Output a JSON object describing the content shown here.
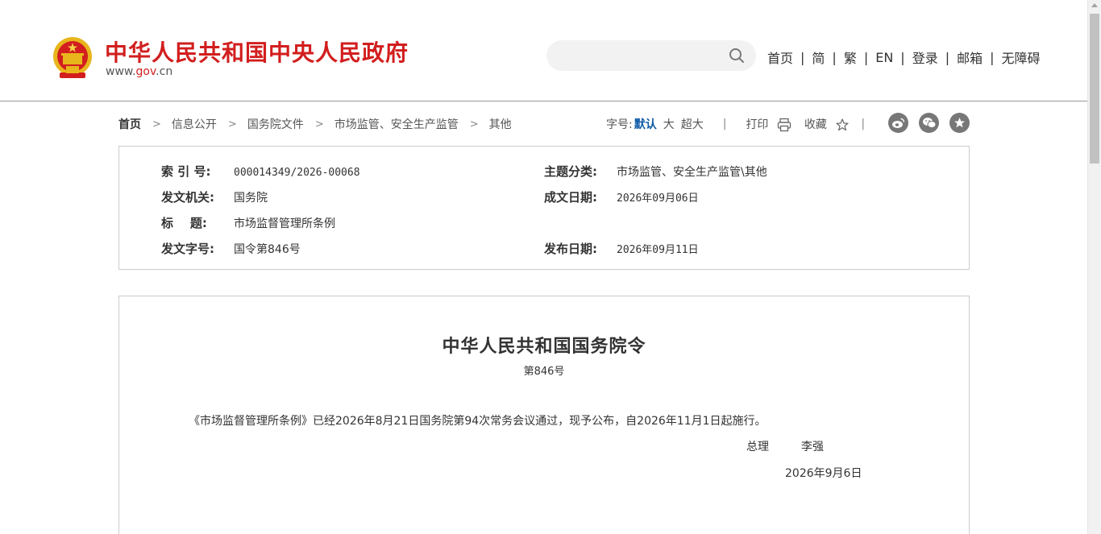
{
  "header": {
    "site_title": "中华人民共和国中央人民政府",
    "site_url_prefix": "www.",
    "site_url_mid": "gov",
    "site_url_suffix": ".cn",
    "search_placeholder": "",
    "nav": [
      "首页",
      "简",
      "繁",
      "EN",
      "登录",
      "邮箱",
      "无障碍"
    ],
    "nav_sep": "|"
  },
  "breadcrumb": [
    "首页",
    "信息公开",
    "国务院文件",
    "市场监管、安全生产监管",
    "其他"
  ],
  "breadcrumb_sep": ">",
  "tools": {
    "font_size_label": "字号:",
    "font_default": "默认",
    "font_large": "大",
    "font_xlarge": "超大",
    "divider": "|",
    "print_label": "打印",
    "favorite_label": "收藏"
  },
  "social_icons": [
    "weibo-icon",
    "wechat-icon",
    "star-share-icon"
  ],
  "info": {
    "index_no_label": "索 引 号:",
    "index_no": "000014349/2026-00068",
    "topic_label": "主题分类:",
    "topic": "市场监管、安全生产监管\\其他",
    "issuer_label": "发文机关:",
    "issuer": "国务院",
    "written_date_label": "成文日期:",
    "written_date": "2026年09月06日",
    "title_label": "标    题:",
    "title": "市场监督管理所条例",
    "doc_no_label": "发文字号:",
    "doc_no": "国令第846号",
    "publish_date_label": "发布日期:",
    "publish_date": "2026年09月11日"
  },
  "article": {
    "title": "中华人民共和国国务院令",
    "number": "第846号",
    "body": "《市场监督管理所条例》已经2026年8月21日国务院第94次常务会议通过，现予公布，自2026年11月1日起施行。",
    "signer_title": "总理",
    "signer_name": "李强",
    "date": "2026年9月6日"
  },
  "colors": {
    "brand_red": "#d21e1e",
    "link_blue": "#0d5aa7"
  }
}
